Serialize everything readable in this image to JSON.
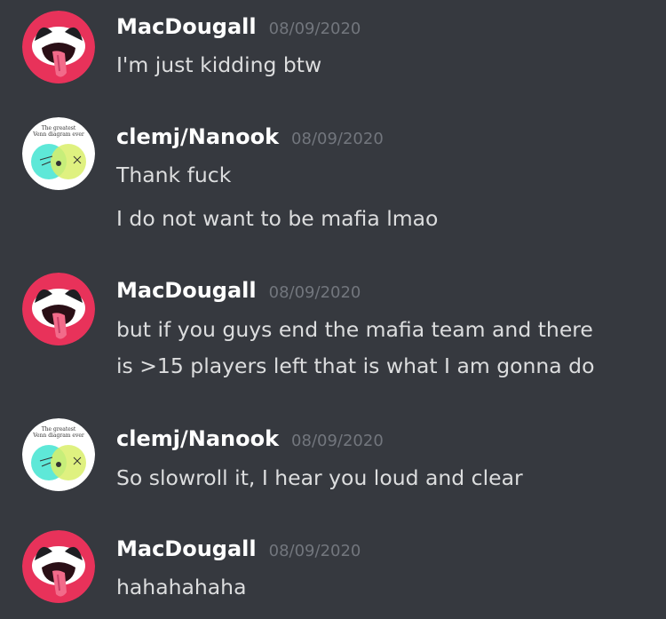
{
  "messages": [
    {
      "author": "MacDougall",
      "timestamp": "08/09/2020",
      "avatar": "tongue-face-avatar",
      "lines": [
        "I'm just kidding btw"
      ]
    },
    {
      "author": "clemj/Nanook",
      "timestamp": "08/09/2020",
      "avatar": "venn-diagram-avatar",
      "avatar_caption": "The greatest Venn diagram ever",
      "lines": [
        "Thank fuck",
        "I do not want to be mafia lmao"
      ]
    },
    {
      "author": "MacDougall",
      "timestamp": "08/09/2020",
      "avatar": "tongue-face-avatar",
      "lines": [
        "but if you guys end the mafia team and there",
        "is >15 players left that is what I am gonna do"
      ]
    },
    {
      "author": "clemj/Nanook",
      "timestamp": "08/09/2020",
      "avatar": "venn-diagram-avatar",
      "avatar_caption": "The greatest Venn diagram ever",
      "lines": [
        "So slowroll it, I hear you loud and clear"
      ]
    },
    {
      "author": "MacDougall",
      "timestamp": "08/09/2020",
      "avatar": "tongue-face-avatar",
      "lines": [
        "hahahahaha"
      ]
    }
  ],
  "colors": {
    "background": "#36393f",
    "username": "#ffffff",
    "timestamp": "#72767d",
    "text": "#dcddde",
    "tongue_avatar_bg": "#e8325a",
    "venn_left": "#5ee8d8",
    "venn_right": "#d9ef6a"
  }
}
